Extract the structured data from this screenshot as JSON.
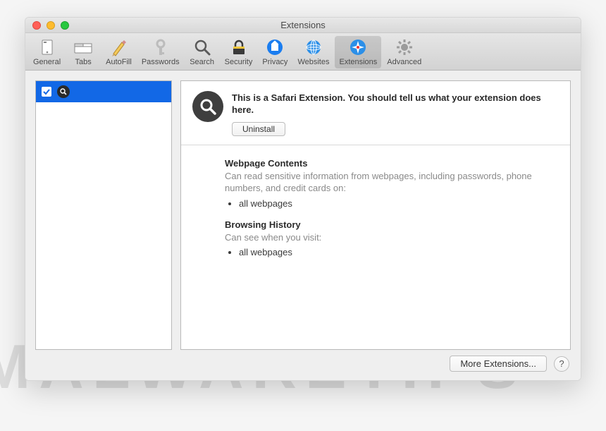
{
  "window": {
    "title": "Extensions"
  },
  "toolbar": {
    "items": [
      {
        "label": "General"
      },
      {
        "label": "Tabs"
      },
      {
        "label": "AutoFill"
      },
      {
        "label": "Passwords"
      },
      {
        "label": "Search"
      },
      {
        "label": "Security"
      },
      {
        "label": "Privacy"
      },
      {
        "label": "Websites"
      },
      {
        "label": "Extensions"
      },
      {
        "label": "Advanced"
      }
    ],
    "selected_index": 8
  },
  "sidebar": {
    "items": [
      {
        "checked": true,
        "icon": "magnifier"
      }
    ],
    "selected_index": 0
  },
  "detail": {
    "description": "This is a Safari Extension. You should tell us what your extension does here.",
    "uninstall_label": "Uninstall",
    "permissions": [
      {
        "title": "Webpage Contents",
        "subtitle": "Can read sensitive information from webpages, including passwords, phone numbers, and credit cards on:",
        "items": [
          "all webpages"
        ]
      },
      {
        "title": "Browsing History",
        "subtitle": "Can see when you visit:",
        "items": [
          "all webpages"
        ]
      }
    ]
  },
  "footer": {
    "more_label": "More Extensions...",
    "help_label": "?"
  },
  "watermark": "MALWARETIPS"
}
